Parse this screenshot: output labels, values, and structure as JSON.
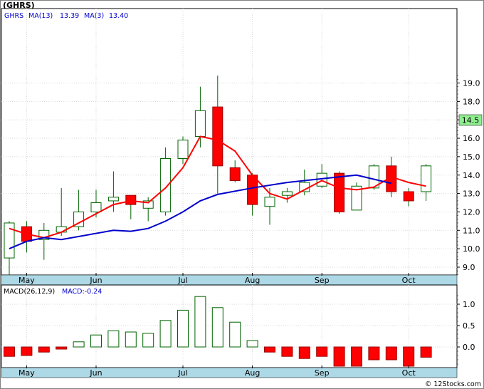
{
  "header": {
    "symbol": "(GHRS)",
    "watermark": "© 12Stocks.com",
    "price_legend": {
      "ticker": "GHRS",
      "ma13_label": "MA(13)",
      "ma13_value": "13.39",
      "ma3_label": "MA(3)",
      "ma3_value": "13.40"
    },
    "macd_legend": {
      "label": "MACD(26,12,9)",
      "value_label": "MACD:-0.24"
    },
    "last_price_tag": "14.5"
  },
  "colors": {
    "up_candle": "#006400",
    "down_candle": "#ff0000",
    "ma13_line": "#0000cc",
    "ma3_line": "#ff0000",
    "axis_band": "#add8e6",
    "grid": "#d9d9d9",
    "price_tag": "#90ee90"
  },
  "chart_data": [
    {
      "type": "candlestick",
      "title": "(GHRS)",
      "x_tick_labels": [
        "May",
        "Jun",
        "Jul",
        "Aug",
        "Sep",
        "Oct"
      ],
      "y_ticks": [
        "9.0",
        "10.0",
        "11.0",
        "12.0",
        "13.0",
        "14.0",
        "15.0",
        "16.0",
        "17.0",
        "18.0",
        "19.0"
      ],
      "ylim": [
        8.5,
        19.4
      ],
      "grid": true,
      "candles": [
        {
          "open": 9.5,
          "high": 11.5,
          "low": 8.6,
          "close": 11.4
        },
        {
          "open": 11.2,
          "high": 11.5,
          "low": 9.8,
          "close": 10.4
        },
        {
          "open": 10.5,
          "high": 11.4,
          "low": 9.4,
          "close": 11.0
        },
        {
          "open": 10.9,
          "high": 13.3,
          "low": 10.7,
          "close": 11.2
        },
        {
          "open": 11.2,
          "high": 13.2,
          "low": 11.0,
          "close": 12.0
        },
        {
          "open": 12.0,
          "high": 13.2,
          "low": 11.7,
          "close": 12.5
        },
        {
          "open": 12.6,
          "high": 14.2,
          "low": 12.0,
          "close": 12.8
        },
        {
          "open": 12.9,
          "high": 12.9,
          "low": 11.6,
          "close": 12.4
        },
        {
          "open": 12.2,
          "high": 12.8,
          "low": 11.5,
          "close": 12.6
        },
        {
          "open": 12.0,
          "high": 15.5,
          "low": 11.8,
          "close": 14.9
        },
        {
          "open": 14.9,
          "high": 16.1,
          "low": 14.6,
          "close": 15.9
        },
        {
          "open": 16.1,
          "high": 18.8,
          "low": 15.5,
          "close": 17.5
        },
        {
          "open": 17.7,
          "high": 19.4,
          "low": 13.0,
          "close": 14.5
        },
        {
          "open": 14.4,
          "high": 14.8,
          "low": 13.6,
          "close": 13.7
        },
        {
          "open": 14.0,
          "high": 14.1,
          "low": 11.8,
          "close": 12.4
        },
        {
          "open": 12.3,
          "high": 13.3,
          "low": 11.3,
          "close": 12.8
        },
        {
          "open": 12.9,
          "high": 13.3,
          "low": 12.5,
          "close": 13.1
        },
        {
          "open": 13.1,
          "high": 14.3,
          "low": 12.9,
          "close": 13.6
        },
        {
          "open": 13.4,
          "high": 14.6,
          "low": 13.3,
          "close": 14.1
        },
        {
          "open": 14.1,
          "high": 14.2,
          "low": 11.9,
          "close": 12.0
        },
        {
          "open": 12.1,
          "high": 13.6,
          "low": 12.1,
          "close": 13.4
        },
        {
          "open": 13.3,
          "high": 14.6,
          "low": 13.2,
          "close": 14.5
        },
        {
          "open": 14.5,
          "high": 15.0,
          "low": 12.8,
          "close": 13.1
        },
        {
          "open": 13.1,
          "high": 13.3,
          "low": 12.3,
          "close": 12.6
        },
        {
          "open": 13.1,
          "high": 14.6,
          "low": 12.6,
          "close": 14.5
        }
      ],
      "series": [
        {
          "name": "MA(13)",
          "values": [
            10.0,
            10.4,
            10.6,
            10.5,
            null,
            null,
            11.0,
            10.95,
            11.1,
            11.5,
            12.0,
            12.6,
            12.95,
            null,
            13.3,
            null,
            13.6,
            null,
            13.8,
            13.9,
            14.0,
            null,
            13.55,
            null,
            null
          ]
        },
        {
          "name": "MA(3)",
          "values": [
            11.1,
            10.8,
            10.6,
            10.9,
            null,
            null,
            12.4,
            12.6,
            12.5,
            13.3,
            14.4,
            16.1,
            15.9,
            15.3,
            14.0,
            13.0,
            12.7,
            13.2,
            13.7,
            13.3,
            13.2,
            13.35,
            13.9,
            13.6,
            13.4
          ]
        }
      ]
    },
    {
      "type": "bar",
      "title": "MACD(26,12,9)",
      "x_tick_labels": [
        "May",
        "Jun",
        "Jul",
        "Aug",
        "Sep",
        "Oct"
      ],
      "y_ticks": [
        "0.0",
        "0.5",
        "1.0"
      ],
      "ylim": [
        -0.5,
        1.25
      ],
      "values": [
        -0.22,
        -0.2,
        -0.12,
        -0.05,
        0.12,
        0.28,
        0.38,
        0.35,
        0.32,
        0.62,
        0.86,
        1.18,
        0.92,
        0.58,
        0.15,
        -0.12,
        -0.22,
        -0.27,
        -0.22,
        -0.45,
        -0.45,
        -0.3,
        -0.3,
        -0.45,
        -0.24
      ]
    }
  ]
}
